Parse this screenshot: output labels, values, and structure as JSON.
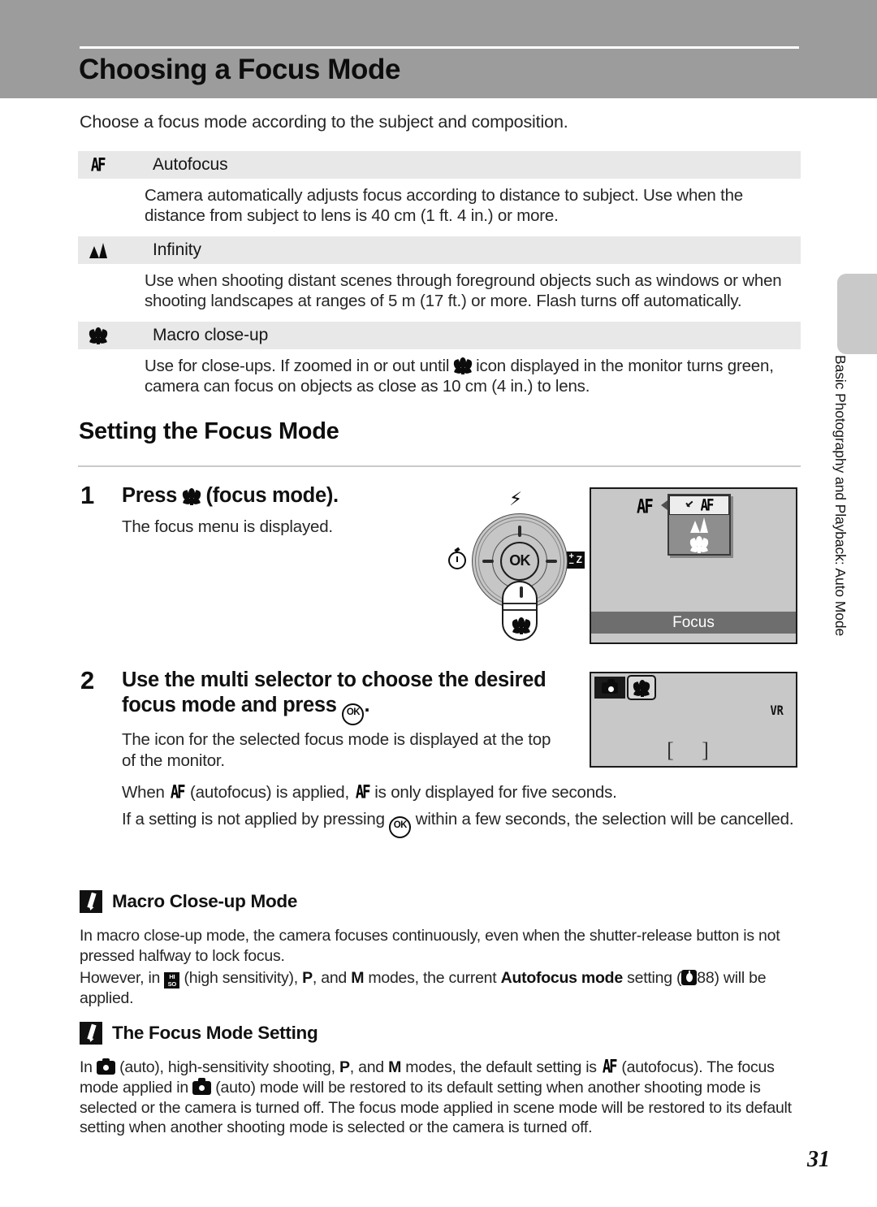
{
  "header": {
    "title": "Choosing a Focus Mode"
  },
  "intro": "Choose a focus mode according to the subject and composition.",
  "modes_table": {
    "rows": [
      {
        "icon": "af-icon",
        "icon_glyph": "AF",
        "label": "Autofocus",
        "body": "Camera automatically adjusts focus according to distance to subject. Use when the distance from subject to lens is 40 cm (1 ft. 4 in.) or more."
      },
      {
        "icon": "mountain-infinity-icon",
        "label": "Infinity",
        "body": "Use when shooting distant scenes through foreground objects such as windows or when shooting landscapes at ranges of 5 m (17 ft.) or more. Flash turns off automatically."
      },
      {
        "icon": "flower-macro-icon",
        "label": "Macro close-up",
        "body_part1": "Use for close-ups. If zoomed in or out until ",
        "body_part2": " icon displayed in the monitor turns green, camera can focus on objects as close as 10 cm (4 in.) to lens."
      }
    ]
  },
  "section": {
    "heading": "Setting the Focus Mode"
  },
  "steps": [
    {
      "number": "1",
      "title_part1": "Press ",
      "title_part2": " (focus mode).",
      "text": "The focus menu is displayed."
    },
    {
      "number": "2",
      "title_part1": "Use the multi selector to choose the desired focus mode and press ",
      "title_part2": ".",
      "text_line1": "The icon for the selected focus mode is displayed at the top of the monitor.",
      "text_line2_a": "When ",
      "text_line2_b": " (autofocus) is applied, ",
      "text_line2_c": " is only displayed for five seconds.",
      "text_line3_a": "If a setting is not applied by pressing ",
      "text_line3_b": " within a few seconds, the selection will be cancelled."
    }
  ],
  "multi_selector": {
    "ok_label": "OK",
    "flash_icon": "flash-icon",
    "timer_icon": "self-timer-icon",
    "ev_icon": "exposure-compensation-icon",
    "focus_icon": "focus-mode-macro-icon"
  },
  "monitor1": {
    "af_indicator": "AF",
    "options": [
      {
        "icon": "check-icon",
        "label": "AF",
        "selected": true
      },
      {
        "icon": "mountain-infinity-icon",
        "label": "",
        "selected": false
      },
      {
        "icon": "flower-macro-icon",
        "label": "",
        "selected": false
      }
    ],
    "bottom_label": "Focus"
  },
  "monitor2": {
    "mode_icon": "camera-auto-icon",
    "focus_icon": "flower-macro-icon",
    "vr_label": "VR",
    "focus_brackets": "[    ]"
  },
  "notes": [
    {
      "icon": "pencil-note-icon",
      "title": "Macro Close-up Mode",
      "line1": "In macro close-up mode, the camera focuses continuously, even when the shutter-release button is not pressed halfway to lock focus.",
      "line2_a": "However, in ",
      "line2_b": " (high sensitivity), ",
      "line2_c": ", and ",
      "line2_d": " modes, the current ",
      "line2_bold": "Autofocus mode",
      "line2_e": " setting (",
      "line2_page": "88",
      "line2_f": ") will be applied.",
      "mode_p": "P",
      "mode_m": "M",
      "hiso_icon": "high-sensitivity-icon",
      "ref_icon": "reference-page-icon"
    },
    {
      "icon": "pencil-note-icon",
      "title": "The Focus Mode Setting",
      "line_a": "In ",
      "line_b": " (auto), high-sensitivity shooting, ",
      "line_c": ", and ",
      "line_d": " modes, the default setting is ",
      "line_e": " (autofocus). The focus mode applied in ",
      "line_f": " (auto) mode will be restored to its default setting when another shooting mode is selected or the camera is turned off. The focus mode applied in scene mode will be restored to its default setting when another shooting mode is selected or the camera is turned off.",
      "mode_p": "P",
      "mode_m": "M"
    }
  ],
  "side_tab": {
    "text": "Basic Photography and Playback: Auto Mode"
  },
  "page_number": "31",
  "colors": {
    "header_band": "#9c9c9c",
    "row_head": "#e8e8e8",
    "monitor_bg": "#c8c8c8",
    "side_tab": "#c9c9c9"
  }
}
